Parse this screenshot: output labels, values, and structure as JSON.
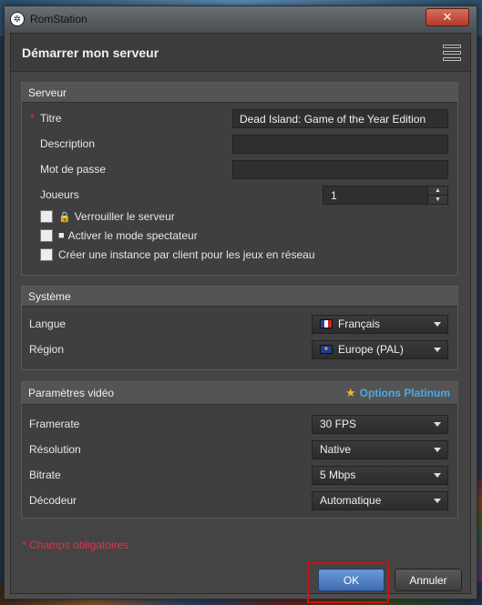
{
  "window": {
    "title": "RomStation",
    "close_symbol": "✕"
  },
  "header": {
    "title": "Démarrer mon serveur"
  },
  "server_panel": {
    "title": "Serveur",
    "required_mark": "*",
    "fields": {
      "title_label": "Titre",
      "title_value": "Dead Island: Game of the Year Edition",
      "description_label": "Description",
      "description_value": "",
      "password_label": "Mot de passe",
      "password_value": "",
      "players_label": "Joueurs",
      "players_value": "1"
    },
    "checkboxes": {
      "lock_label": "Verrouiller le serveur",
      "spectator_label": "Activer le mode spectateur",
      "instance_label": "Créer une instance par client pour les jeux en réseau"
    }
  },
  "system_panel": {
    "title": "Système",
    "language_label": "Langue",
    "language_value": "Français",
    "region_label": "Région",
    "region_value": "Europe (PAL)"
  },
  "video_panel": {
    "title": "Paramètres vidéo",
    "platinum_link": "Options Platinum",
    "framerate_label": "Framerate",
    "framerate_value": "30 FPS",
    "resolution_label": "Résolution",
    "resolution_value": "Native",
    "bitrate_label": "Bitrate",
    "bitrate_value": "5 Mbps",
    "decoder_label": "Décodeur",
    "decoder_value": "Automatique"
  },
  "footer": {
    "required_note": "* Champs obligatoires",
    "ok_label": "OK",
    "cancel_label": "Annuler"
  },
  "colors": {
    "accent_blue": "#4aa8e8",
    "required_red": "#e0324e",
    "ok_button": "#4f7fc4",
    "highlight_box": "#d01010"
  }
}
